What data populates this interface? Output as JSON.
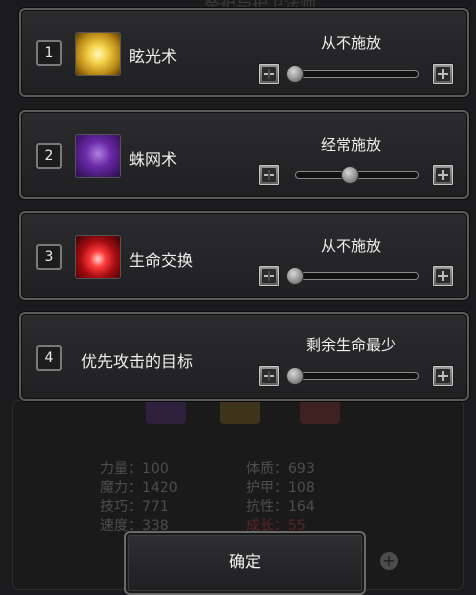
{
  "background": {
    "title": "祭祀与护卫法师",
    "stats": [
      {
        "label": "力量：100"
      },
      {
        "label": "魔力：1420"
      },
      {
        "label": "技巧：771"
      },
      {
        "label": "速度：338"
      },
      {
        "label": "体质：693"
      },
      {
        "label": "护甲：108"
      },
      {
        "label": "抗性：164"
      },
      {
        "label": "成长：55"
      }
    ]
  },
  "rows": [
    {
      "number": "1",
      "name": "眩光术",
      "frequency": "从不施放",
      "slider_value": 0.0,
      "icon": "glare-icon"
    },
    {
      "number": "2",
      "name": "蛛网术",
      "frequency": "经常施放",
      "slider_value": 0.5,
      "icon": "web-icon"
    },
    {
      "number": "3",
      "name": "生命交换",
      "frequency": "从不施放",
      "slider_value": 0.0,
      "icon": "life-swap-icon"
    },
    {
      "number": "4",
      "name": "优先攻击的目标",
      "frequency": "剩余生命最少",
      "slider_value": 0.0,
      "icon": ""
    }
  ],
  "confirm_label": "确定",
  "colors": {
    "growth_stat": "#7a2a2a"
  }
}
